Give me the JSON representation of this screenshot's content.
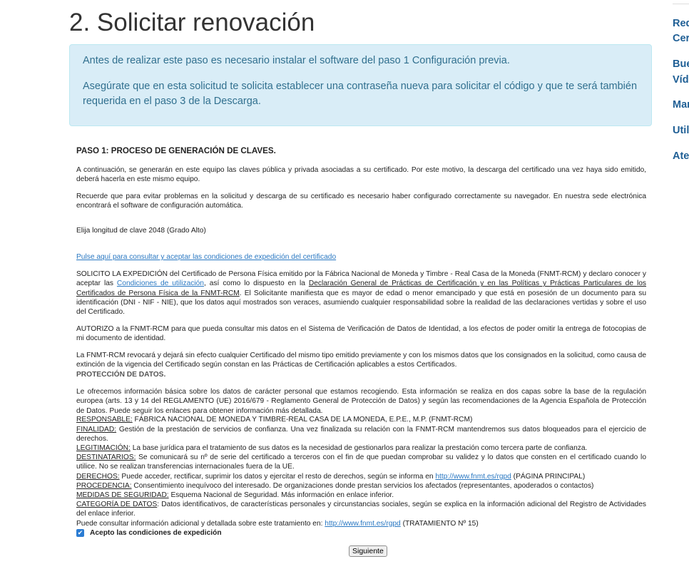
{
  "page": {
    "title": "2. Solicitar renovación",
    "alert": {
      "p1": "Antes de realizar este paso es necesario instalar el software del paso 1 Configuración previa.",
      "p2": "Asegúrate que en esta solicitud te solicita establecer una contraseña nueva para solicitar el código y que te será también requerida en el paso 3 de la Descarga."
    }
  },
  "form": {
    "step_title": "PASO 1: PROCESO DE GENERACIÓN DE CLAVES.",
    "intro1": "A continuación, se generarán en este equipo las claves pública y privada asociadas a su certificado. Por este motivo, la descarga del certificado una vez haya sido emitido, deberá hacerla en este mismo equipo.",
    "intro2": "Recuerde que para evitar problemas en la solicitud y descarga de su certificado es necesario haber configurado correctamente su navegador. En nuestra sede electrónica encontrará el software de configuración automática.",
    "key_length": "Elija longitud de clave 2048  (Grado Alto)",
    "conditions_link": "Pulse aquí para consultar y aceptar las condiciones de expedición del certificado",
    "solicito": {
      "a": "SOLICITO LA EXPEDICIÓN del Certificado de Persona Física emitido por la Fábrica Nacional de Moneda y Timbre - Real Casa de la Moneda (FNMT-RCM) y declaro conocer y aceptar las ",
      "link1": "Condiciones de utilización",
      "b": ", así como lo dispuesto en la ",
      "link2": "Declaración General de Prácticas de Certificación y en las Políticas y Prácticas Particulares de los Certificados de Persona Física de la FNMT-RCM",
      "c": ". El Solicitante manifiesta que es mayor de edad o menor emancipado y que está en posesión de un documento para su identificación (DNI - NIF - NIE), que los datos aquí mostrados son veraces, asumiendo cualquier responsabilidad sobre la realidad de las declaraciones vertidas y sobre el uso del Certificado."
    },
    "autorizo": "AUTORIZO a la FNMT-RCM para que pueda consultar mis datos en el Sistema de Verificación de Datos de Identidad, a los efectos de poder omitir la entrega de fotocopias de mi documento de identidad.",
    "revoke": "La FNMT-RCM revocará y dejará sin efecto cualquier Certificado del mismo tipo emitido previamente y con los mismos datos que los consignados en la solicitud, como causa de extinción de la vigencia del Certificado según constan en las Prácticas de Certificación aplicables a estos Certificados.",
    "protection_title": "PROTECCIÓN DE DATOS.",
    "protection_intro": "Le ofrecemos información básica sobre los datos de carácter personal que estamos recogiendo. Esta información se realiza en dos capas sobre la base de la regulación europea (arts. 13 y 14 del REGLAMENTO (UE) 2016/679 - Reglamento General de Protección de Datos) y según las recomendaciones de la Agencia Española de Protección de Datos. Puede seguir los enlaces para obtener información más detallada.",
    "responsable_label": "RESPONSABLE:",
    "responsable_text": " FÁBRICA NACIONAL DE MONEDA Y TIMBRE-REAL CASA DE LA MONEDA, E.P.E., M.P. (FNMT-RCM)",
    "finalidad_label": "FINALIDAD:",
    "finalidad_text": " Gestión de la prestación de servicios de confianza. Una vez finalizada su relación con la FNMT-RCM mantendremos sus datos bloqueados para el ejercicio de derechos.",
    "legitimacion_label": "LEGITIMACIÓN:",
    "legitimacion_text": " La base jurídica para el tratamiento de sus datos es la necesidad de gestionarlos para realizar la prestación como tercera parte de confianza.",
    "destinatarios_label": "DESTINATARIOS:",
    "destinatarios_text": " Se comunicará su nº de serie del certificado a terceros con el fin de que puedan comprobar su validez y lo datos que consten en el certificado cuando lo utilice. No se realizan transferencias internacionales fuera de la UE.",
    "derechos_label": "DERECHOS:",
    "derechos_text": " Puede acceder, rectificar, suprimir los datos y ejercitar el resto de derechos, según se informa en ",
    "derechos_link": "http://www.fnmt.es/rgpd",
    "derechos_after": " (PÁGINA PRINCIPAL)",
    "procedencia_label": "PROCEDENCIA:",
    "procedencia_text": " Consentimiento inequívoco del interesado. De organizaciones donde prestan servicios los afectados (representantes, apoderados o contactos)",
    "medidas_label": "MEDIDAS DE SEGURIDAD:",
    "medidas_text": " Esquema Nacional de Seguridad. Más información en enlace inferior.",
    "categoria_label": "CATEGORÍA DE DATOS",
    "categoria_text": ": Datos identificativos, de características personales y circunstancias sociales, según se explica en la información adicional del Registro de Actividades del enlace inferior.",
    "consult_text": "Puede consultar información adicional y detallada sobre este tratamiento en: ",
    "consult_link": "http://www.fnmt.es/rgpd",
    "consult_after": " (TRATAMIENTO Nº 15)",
    "accept_label": "Acepto las condiciones de expedición",
    "accept_checked": true,
    "next_button": "Siguiente"
  },
  "sidebar": {
    "items": [
      "Req",
      "Cer",
      "Bue",
      "Víd",
      "Man",
      "Util",
      "Ate"
    ]
  },
  "colors": {
    "alert_bg": "#d9edf7",
    "alert_text": "#31708f",
    "link": "#2a78c2",
    "sidebar_link": "#1f5f95",
    "checkbox": "#2b7cd3"
  }
}
